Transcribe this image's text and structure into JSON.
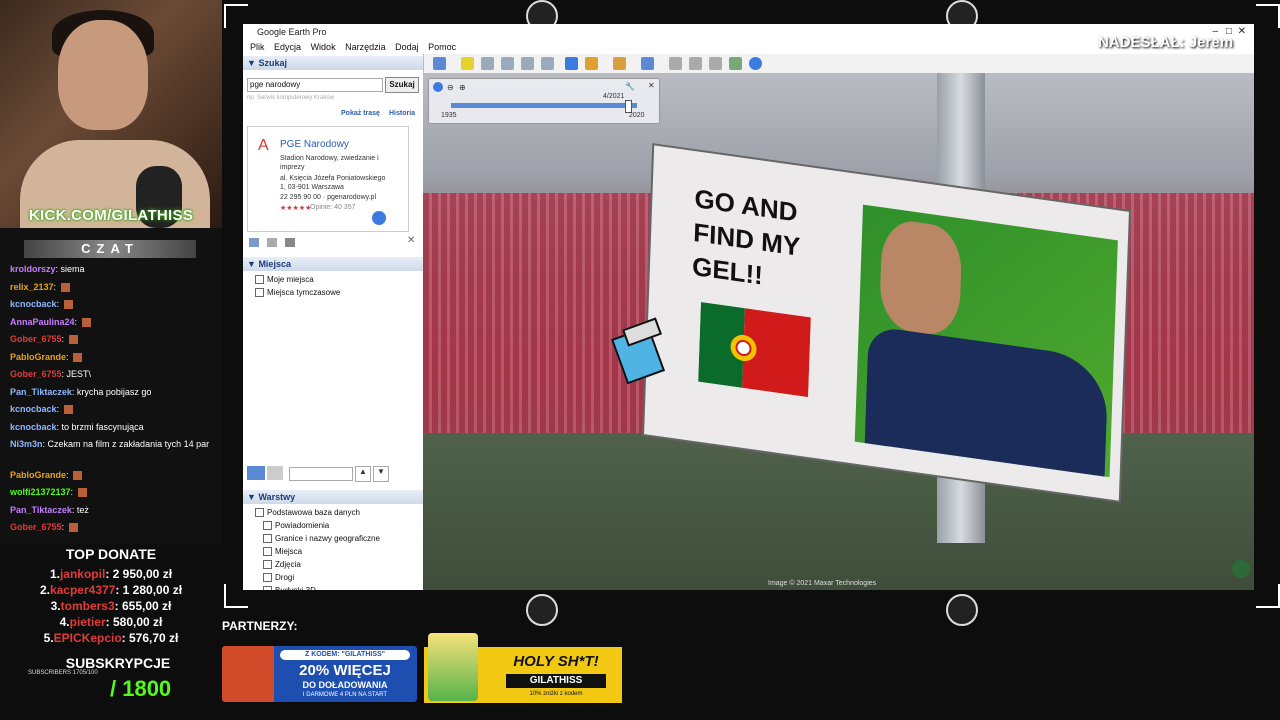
{
  "stream": {
    "kick_label": "KICK.COM/GILATHISS",
    "submitted_by": "NADESŁAŁ: Jerem"
  },
  "chat": {
    "header": "CZAT",
    "messages": [
      {
        "user": "kroldorszy",
        "text": "siema",
        "color": "#c77dff"
      },
      {
        "user": "relix_2137",
        "text": "",
        "color": "#e6a21c",
        "emote": true
      },
      {
        "user": "kcnocback",
        "text": "",
        "color": "#8fb8ff",
        "emote": true
      },
      {
        "user": "AnnaPaulina24",
        "text": "",
        "color": "#c77dff",
        "emote": true
      },
      {
        "user": "Gober_6755",
        "text": "",
        "color": "#e23a3a",
        "emote": true
      },
      {
        "user": "PabloGrande",
        "text": "",
        "color": "#e6a21c",
        "emote": true
      },
      {
        "user": "Gober_6755",
        "text": "JEST\\",
        "color": "#e23a3a"
      },
      {
        "user": "Pan_Tiktaczek",
        "text": "krycha pobijasz go",
        "color": "#8fb8ff"
      },
      {
        "user": "kcnocback",
        "text": "",
        "color": "#8fb8ff",
        "emote": true
      },
      {
        "user": "kcnocback",
        "text": "to brzmi fascynująca",
        "color": "#8fb8ff"
      },
      {
        "user": "Ni3m3n",
        "text": "Czekam na film z zakładania tych 14 par",
        "color": "#8fb8ff"
      },
      {
        "user": "PabloGrande",
        "text": "",
        "color": "#e6a21c",
        "emote": true
      },
      {
        "user": "wolfi21372137",
        "text": "",
        "color": "#53fc18",
        "emote": true
      },
      {
        "user": "Pan_Tiktaczek",
        "text": "też",
        "color": "#c77dff"
      },
      {
        "user": "Gober_6755",
        "text": "",
        "color": "#e23a3a",
        "emote": true
      }
    ]
  },
  "top_donate": {
    "title": "TOP DONATE",
    "entries": [
      {
        "rank": "1.",
        "name": "jankopil",
        "amount": ": 2 950,00 zł"
      },
      {
        "rank": "2.",
        "name": "kacper4377",
        "amount": ": 1 280,00 zł"
      },
      {
        "rank": "3.",
        "name": "tombers3",
        "amount": ": 655,00 zł"
      },
      {
        "rank": "4.",
        "name": "pietier",
        "amount": ": 580,00 zł"
      },
      {
        "rank": "5.",
        "name": "EPICKepcio",
        "amount": ": 576,70 zł"
      }
    ]
  },
  "subs": {
    "title": "SUBSKRYPCJE",
    "small": "SUBSCRIBERS 1705/100",
    "goal": "/ 1800"
  },
  "partners": {
    "label": "PARTNERZY:",
    "ad1": {
      "code_label": "Z KODEM: \"GILATHISS\"",
      "headline": "20% WIĘCEJ",
      "sub": "DO DOŁADOWANIA",
      "note": "I DARMOWE 4 PLN NA START"
    },
    "ad2": {
      "headline": "HOLY SH*T!",
      "code": "GILATHISS",
      "note": "10% zniżki z kodem"
    }
  },
  "app": {
    "title": "Google Earth Pro",
    "menu": [
      "Plik",
      "Edycja",
      "Widok",
      "Narzędzia",
      "Dodaj",
      "Pomoc"
    ],
    "search": {
      "panel_title": "Szukaj",
      "query": "pge narodowy",
      "button": "Szukaj",
      "hint": "np. Serwis komputerowy Kraków",
      "route_link": "Pokaż trasę",
      "history_link": "Historia",
      "result_letter": "A",
      "result_title": "PGE Narodowy",
      "result_desc": "Stadion Narodowy, zwiedzanie i imprezy",
      "result_address": "al. Księcia Józefa Poniatowskiego 1, 03-901 Warszawa",
      "result_phone": "22 295 90 00 · pgenarodowy.pl",
      "result_rating": "Opinie: 40 357"
    },
    "places": {
      "title": "Miejsca",
      "items": [
        "Moje miejsca",
        "Miejsca tymczasowe"
      ]
    },
    "layers": {
      "title": "Warstwy",
      "root": "Podstawowa baza danych",
      "items": [
        "Powiadomienia",
        "Granice i nazwy geograficzne",
        "Miejsca",
        "Zdjęcia",
        "Drogi",
        "Budynki 3D",
        "Pogoda"
      ]
    },
    "timeline": {
      "date": "4/2021",
      "start": "1935",
      "end": "2020"
    },
    "sign_text": "GO AND FIND MY GEL!!",
    "copyright": "Image © 2021 Maxar Technologies"
  }
}
